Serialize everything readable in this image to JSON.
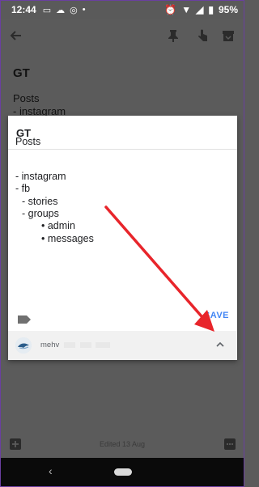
{
  "status_bar": {
    "time": "12:44",
    "battery": "95%"
  },
  "background_note": {
    "title": "GT",
    "lines": [
      "Posts",
      "- instagram"
    ]
  },
  "dialog": {
    "title": "GT",
    "body_lines": [
      "Posts",
      "- instagram",
      "- fb",
      "- stories",
      "- groups",
      "• admin",
      "• messages"
    ],
    "save_label": "SAVE",
    "owner_text": "mehv"
  },
  "bottom_bar": {
    "edited_text": "Edited 13 Aug"
  },
  "colors": {
    "accent_blue": "#4285f4",
    "arrow_red": "#e8252b",
    "scrim": "#5b5b5b"
  }
}
